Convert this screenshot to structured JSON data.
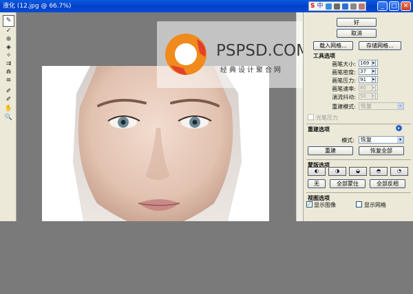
{
  "window": {
    "title": "液化 (12.jpg @ 66.7%)",
    "min_glyph": "_",
    "max_glyph": "□",
    "close_glyph": "✕"
  },
  "tray": {
    "logo": "S",
    "lang": "中",
    "extra": "ㄅ"
  },
  "tools": [
    {
      "name": "forward-warp-tool",
      "glyph": "✎",
      "active": true
    },
    {
      "name": "reconstruct-tool",
      "glyph": "✓"
    },
    {
      "name": "twirl-tool",
      "glyph": "⊛"
    },
    {
      "name": "pucker-tool",
      "glyph": "◈"
    },
    {
      "name": "bloat-tool",
      "glyph": "✧"
    },
    {
      "name": "push-left-tool",
      "glyph": "⇉"
    },
    {
      "name": "mirror-tool",
      "glyph": "⋒"
    },
    {
      "name": "turbulence-tool",
      "glyph": "≋"
    },
    {
      "name": "freeze-mask-tool",
      "glyph": "✐"
    },
    {
      "name": "thaw-mask-tool",
      "glyph": "✐"
    },
    {
      "name": "hand-tool",
      "glyph": "✋"
    },
    {
      "name": "zoom-tool",
      "glyph": "🔍"
    }
  ],
  "watermark": {
    "brand": "PSPSD.COM",
    "tagline": "经典设计聚合网"
  },
  "panel": {
    "ok_label": "好",
    "cancel_label": "取消",
    "load_mesh_label": "载入网格...",
    "save_mesh_label": "存储网格...",
    "tool_options_title": "工具选项",
    "brush_size_label": "画笔大小:",
    "brush_size_value": "169",
    "brush_density_label": "画笔密度:",
    "brush_density_value": "37",
    "brush_pressure_label": "画笔压力:",
    "brush_pressure_value": "91",
    "brush_rate_label": "画笔速率:",
    "brush_rate_value": "80",
    "turbulent_jitter_label": "湍流抖动:",
    "turbulent_jitter_value": "50",
    "reconstruct_mode_label": "重建模式:",
    "reconstruct_mode_value": "恢复",
    "stylus_pressure_label": "光笔压力",
    "reconstruct_options_title": "重建选项",
    "mode_label": "模式:",
    "mode_value": "恢复",
    "reconstruct_button": "重建",
    "restore_all_button": "恢复全部",
    "mask_options_title": "蒙版选项",
    "none_button": "无",
    "mask_all_button": "全部蒙住",
    "invert_all_button": "全部反相",
    "view_options_title": "视图选项",
    "show_image_label": "显示图像",
    "show_image_checked": true,
    "show_mesh_label": "显示网格",
    "show_mesh_checked": false
  }
}
